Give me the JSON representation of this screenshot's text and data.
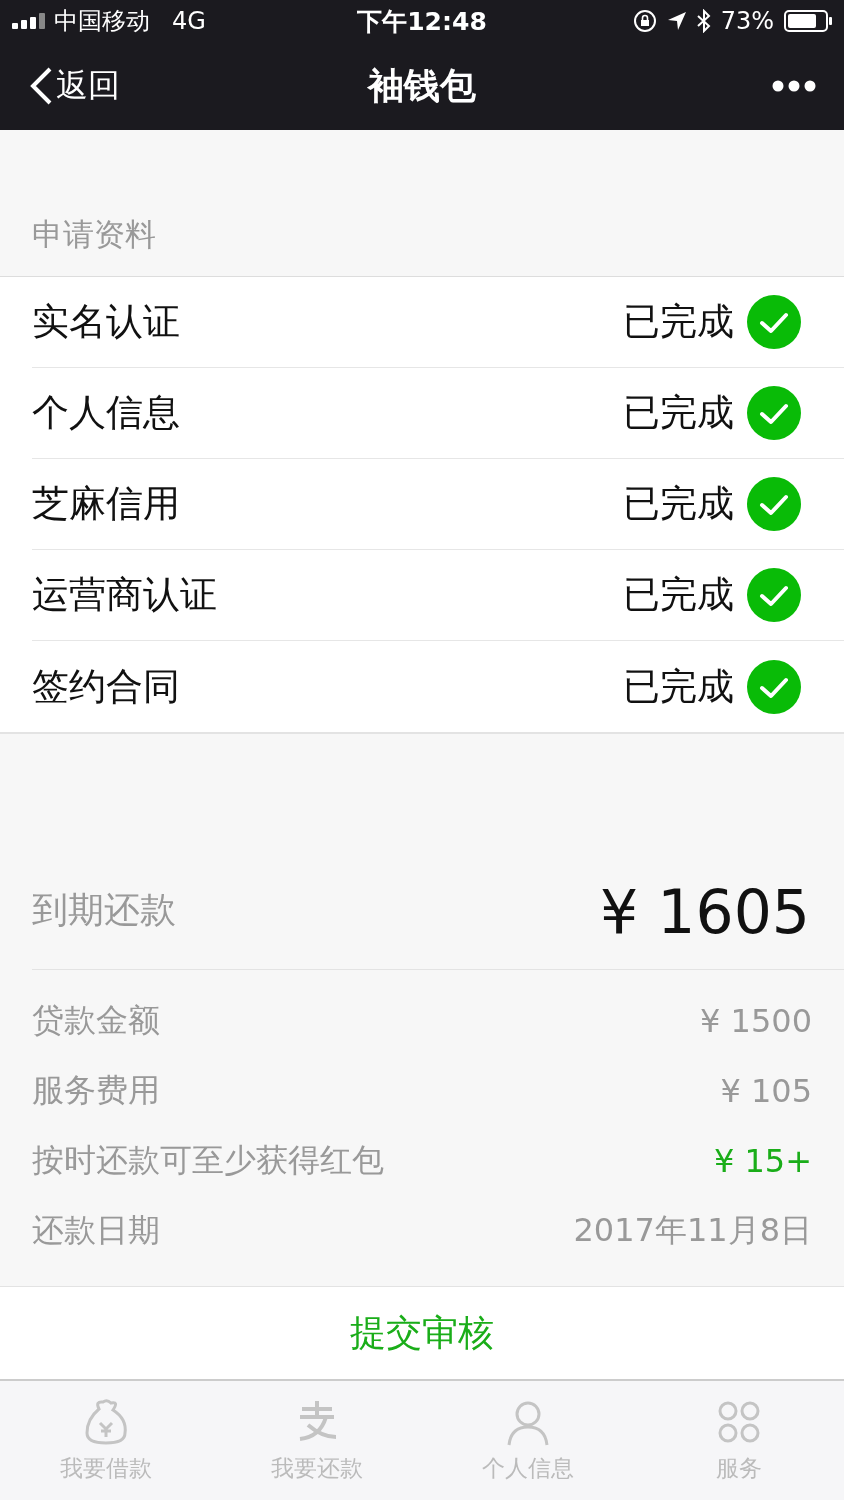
{
  "status_bar": {
    "carrier": "中国移动",
    "network": "4G",
    "time": "下午12:48",
    "battery": "73%"
  },
  "nav": {
    "back": "返回",
    "title": "袖钱包"
  },
  "section": {
    "title": "申请资料"
  },
  "items": [
    {
      "label": "实名认证",
      "status": "已完成",
      "done": true
    },
    {
      "label": "个人信息",
      "status": "已完成",
      "done": true
    },
    {
      "label": "芝麻信用",
      "status": "已完成",
      "done": true
    },
    {
      "label": "运营商认证",
      "status": "已完成",
      "done": true
    },
    {
      "label": "签约合同",
      "status": "已完成",
      "done": true
    }
  ],
  "due": {
    "label": "到期还款",
    "amount": "¥ 1605"
  },
  "details": [
    {
      "label": "贷款金额",
      "value": "¥ 1500",
      "highlighted": false
    },
    {
      "label": "服务费用",
      "value": "¥ 105",
      "highlighted": false
    },
    {
      "label": "按时还款可至少获得红包",
      "value": "¥ 15+",
      "highlighted": true
    },
    {
      "label": "还款日期",
      "value": "2017年11月8日",
      "highlighted": false
    }
  ],
  "submit": "提交审核",
  "tabs": [
    {
      "label": "我要借款",
      "selected": false
    },
    {
      "label": "我要还款",
      "selected": false
    },
    {
      "label": "个人信息",
      "selected": false
    },
    {
      "label": "服务",
      "selected": false
    }
  ]
}
